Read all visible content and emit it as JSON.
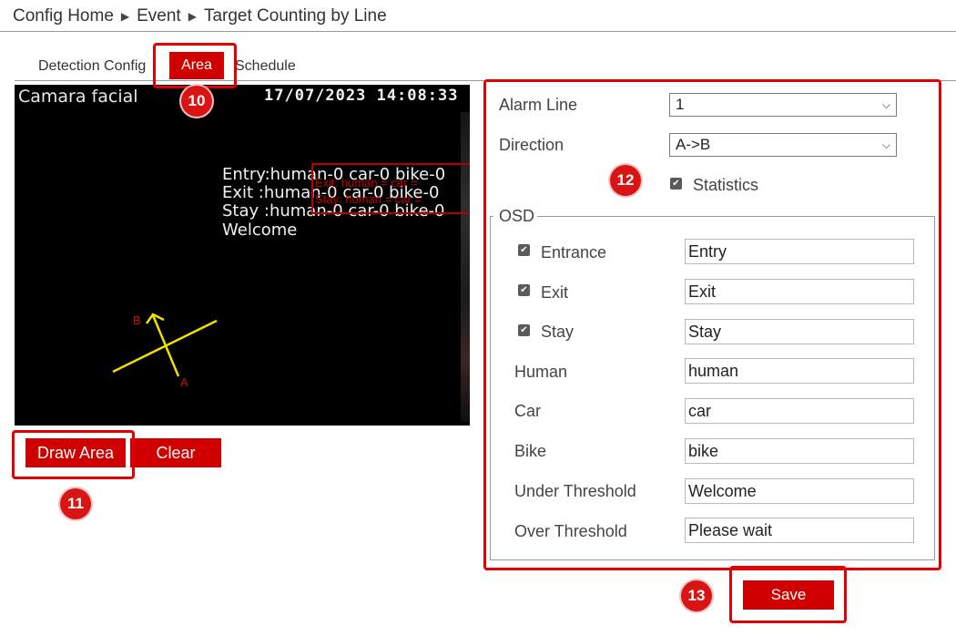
{
  "breadcrumb": {
    "items": [
      "Config Home",
      "Event",
      "Target Counting by Line"
    ],
    "separator": "▶"
  },
  "tabs": [
    {
      "label": "Detection Config"
    },
    {
      "label": "Area",
      "active": true
    },
    {
      "label": "Schedule"
    }
  ],
  "video": {
    "camera_name": "Camara facial",
    "timestamp": "17/07/2023  14:08:33",
    "osd_lines": [
      "Entry:human-0 car-0 bike-0",
      "Exit :human-0 car-0 bike-0",
      "Stay :human-0 car-0 bike-0",
      "Welcome"
    ],
    "overlay_lines": [
      "Exit: human = car =",
      "Stay: human = car ="
    ],
    "line_endpoint_a": "A",
    "line_endpoint_b": "B"
  },
  "buttons": {
    "draw_area": "Draw Area",
    "clear": "Clear",
    "save": "Save"
  },
  "badges": [
    "10",
    "11",
    "12",
    "13"
  ],
  "settings": {
    "alarm_line": {
      "label": "Alarm Line",
      "value": "1"
    },
    "direction": {
      "label": "Direction",
      "value": "A->B"
    },
    "statistics": {
      "label": "Statistics",
      "checked": true
    },
    "osd_title": "OSD",
    "osd_rows": [
      {
        "label": "Entrance",
        "checked": true,
        "value": "Entry"
      },
      {
        "label": "Exit",
        "checked": true,
        "value": "Exit"
      },
      {
        "label": "Stay",
        "checked": true,
        "value": "Stay"
      },
      {
        "label": "Human",
        "value": "human"
      },
      {
        "label": "Car",
        "value": "car"
      },
      {
        "label": "Bike",
        "value": "bike"
      },
      {
        "label": "Under Threshold",
        "value": "Welcome"
      },
      {
        "label": "Over Threshold",
        "value": "Please wait"
      }
    ]
  },
  "colors": {
    "accent": "#d10000",
    "highlight": "#e20000",
    "line_yellow": "#f0e000"
  }
}
